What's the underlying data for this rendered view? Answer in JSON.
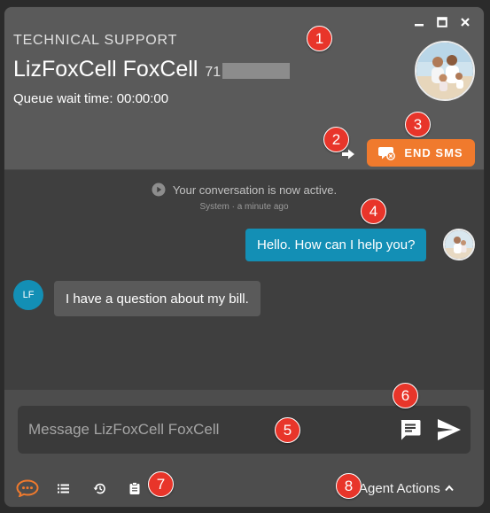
{
  "header": {
    "queue_name": "TECHNICAL SUPPORT",
    "contact_name": "LizFoxCell FoxCell",
    "phone_visible": "71",
    "wait_time": "Queue wait time: 00:00:00",
    "end_button_label": "END SMS"
  },
  "window_controls": [
    "minimize-icon",
    "maximize-icon",
    "close-icon"
  ],
  "conversation": {
    "system_message": "Your conversation is now active.",
    "system_meta": "System · a minute ago",
    "messages": [
      {
        "sender": "agent",
        "text": "Hello. How can I help you?"
      },
      {
        "sender": "customer",
        "initials": "LF",
        "text": "I have a question about my bill."
      }
    ]
  },
  "compose": {
    "placeholder": "Message LizFoxCell FoxCell",
    "value": ""
  },
  "toolbar": {
    "icons": [
      "chat-icon",
      "list-icon",
      "history-icon",
      "clipboard-icon"
    ],
    "agent_actions_label": "Agent Actions"
  },
  "markers": [
    "1",
    "2",
    "3",
    "4",
    "5",
    "6",
    "7",
    "8"
  ],
  "colors": {
    "accent_orange": "#f07a2d",
    "agent_bubble": "#138fb5",
    "marker_red": "#e8352a"
  }
}
